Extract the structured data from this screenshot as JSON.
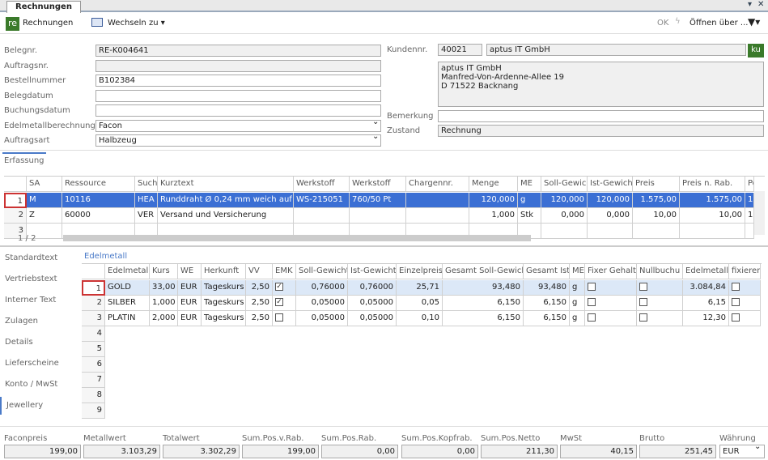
{
  "window": {
    "tab": "Rechnungen",
    "collapse": "▾",
    "close": "✕"
  },
  "toolbar": {
    "logo": "re",
    "title": "Rechnungen",
    "switch": "Wechseln zu",
    "ok": "OK",
    "open": "Öffnen über ..."
  },
  "form": {
    "left": [
      {
        "label": "Belegnr.",
        "value": "RE-K004641",
        "readonly": true
      },
      {
        "label": "Auftragsnr.",
        "value": "",
        "readonly": true
      },
      {
        "label": "Bestellnummer",
        "value": "B102384",
        "readonly": false
      },
      {
        "label": "Belegdatum",
        "value": "",
        "readonly": false
      },
      {
        "label": "Buchungsdatum",
        "value": "",
        "readonly": false
      },
      {
        "label": "Edelmetallberechnung",
        "value": "Facon",
        "readonly": false,
        "dropdown": true
      },
      {
        "label": "Auftragsart",
        "value": "Halbzeug",
        "readonly": false,
        "dropdown": true
      }
    ],
    "kundennr_label": "Kundennr.",
    "kundennr": "40021",
    "kunde": "aptus IT GmbH",
    "ku_button": "ku",
    "address": [
      "aptus IT GmbH",
      "Manfred-Von-Ardenne-Allee 19",
      "D 71522 Backnang"
    ],
    "bemerkung_label": "Bemerkung",
    "bemerkung": "",
    "zustand_label": "Zustand",
    "zustand": "Rechnung"
  },
  "erfassung": {
    "tab": "Erfassung",
    "pager": "1 / 2",
    "columns": [
      "",
      "SA",
      "Ressource",
      "Such",
      "Kurztext",
      "Werkstoff",
      "Werkstoff",
      "Chargennr.",
      "Menge",
      "ME",
      "Soll-Gewic",
      "Ist-Gewich",
      "Preis",
      "Preis n. Rab.",
      "Po"
    ],
    "rows": [
      [
        "1",
        "M",
        "10116",
        "HEA",
        "Runddraht Ø 0,24 mm weich auf S",
        "WS-215051",
        "760/50 Pt",
        "",
        "120,000",
        "g",
        "120,000",
        "120,000",
        "1.575,00",
        "1.575,00",
        "1"
      ],
      [
        "2",
        "Z",
        "60000",
        "VER",
        "Versand und Versicherung",
        "",
        "",
        "",
        "1,000",
        "Stk",
        "0,000",
        "0,000",
        "10,00",
        "10,00",
        "1"
      ],
      [
        "3",
        "",
        "",
        "",
        "",
        "",
        "",
        "",
        "",
        "",
        "",
        "",
        "",
        "",
        ""
      ]
    ]
  },
  "nav": [
    "Standardtext",
    "Vertriebstext",
    "Interner Text",
    "Zulagen",
    "Details",
    "Lieferscheine",
    "Konto / MwSt",
    "Jewellery"
  ],
  "nav_selected": "Jewellery",
  "edelmetall": {
    "group": "Edelmetall",
    "columns": [
      "",
      "Edelmetall",
      "Kurs",
      "WE",
      "Herkunft",
      "VV",
      "EMK",
      "Soll-Gewicht",
      "Ist-Gewicht",
      "Einzelpreis",
      "Gesamt Soll-Gewicht",
      "Gesamt Ist",
      "ME",
      "Fixer Gehalt",
      "Nullbuchu",
      "Edelmetall",
      "fixieren"
    ],
    "rows": [
      [
        "1",
        "GOLD",
        "33,00",
        "EUR",
        "Tageskurs",
        "2,50",
        true,
        "0,76000",
        "0,76000",
        "25,71",
        "93,480",
        "93,480",
        "g",
        false,
        false,
        "3.084,84",
        false
      ],
      [
        "2",
        "SILBER",
        "1,000",
        "EUR",
        "Tageskurs",
        "2,50",
        true,
        "0,05000",
        "0,05000",
        "0,05",
        "6,150",
        "6,150",
        "g",
        false,
        false,
        "6,15",
        false
      ],
      [
        "3",
        "PLATIN",
        "2,000",
        "EUR",
        "Tageskurs",
        "2,50",
        false,
        "0,05000",
        "0,05000",
        "0,10",
        "6,150",
        "6,150",
        "g",
        false,
        false,
        "12,30",
        false
      ]
    ],
    "empty_rows": [
      "4",
      "5",
      "6",
      "7",
      "8",
      "9"
    ]
  },
  "totals": [
    {
      "label": "Faconpreis",
      "value": "199,00"
    },
    {
      "label": "Metallwert",
      "value": "3.103,29"
    },
    {
      "label": "Totalwert",
      "value": "3.302,29"
    },
    {
      "label": "Sum.Pos.v.Rab.",
      "value": "199,00"
    },
    {
      "label": "Sum.Pos.Rab.",
      "value": "0,00"
    },
    {
      "label": "Sum.Pos.Kopfrab.",
      "value": "0,00"
    },
    {
      "label": "Sum.Pos.Netto",
      "value": "211,30"
    },
    {
      "label": "MwSt",
      "value": "40,15"
    },
    {
      "label": "Brutto",
      "value": "251,45"
    },
    {
      "label": "Währung",
      "value": "EUR"
    }
  ],
  "colors": {
    "selection": "#3b6fd4",
    "accent": "#4a7ac8",
    "logo": "#3a7a2a"
  }
}
